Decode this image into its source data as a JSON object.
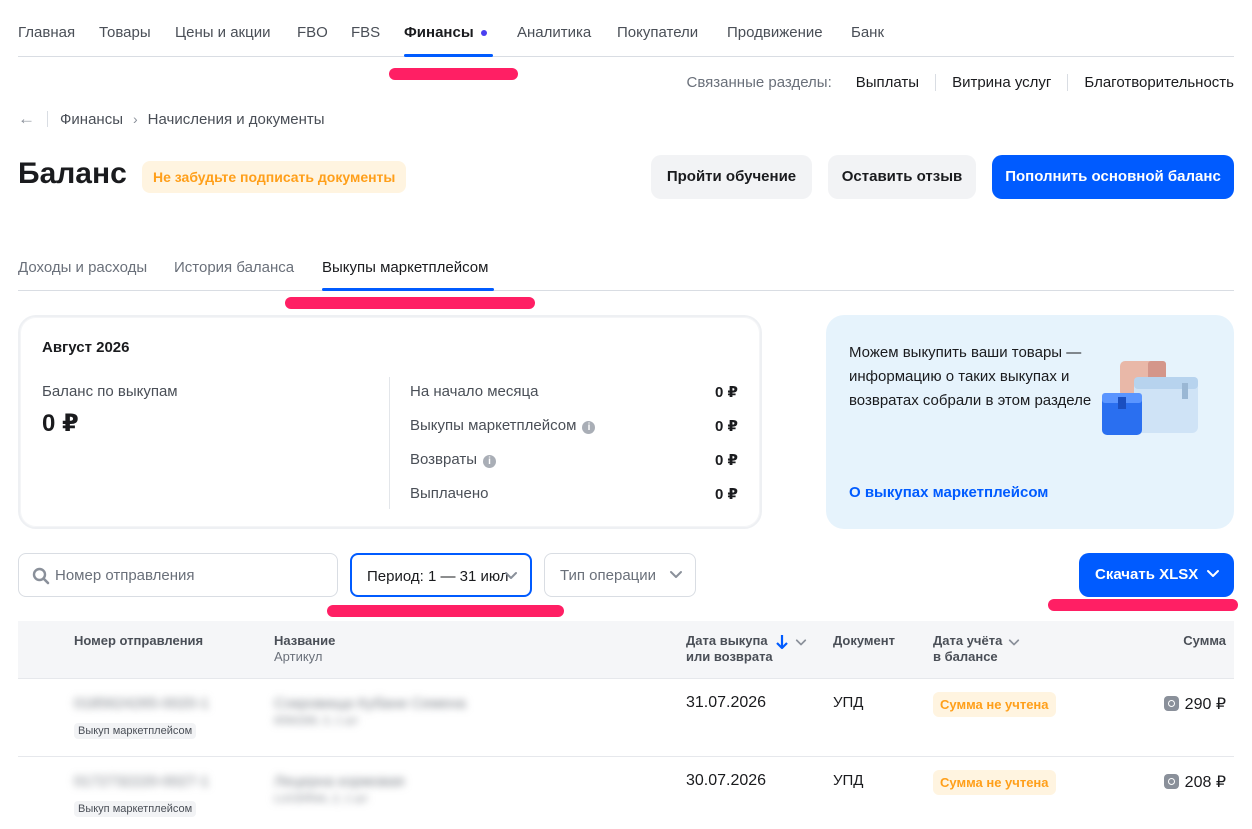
{
  "topnav": {
    "items": [
      "Главная",
      "Товары",
      "Цены и акции",
      "FBO",
      "FBS",
      "Финансы",
      "Аналитика",
      "Покупатели",
      "Продвижение",
      "Банк"
    ],
    "active_index": 5
  },
  "related": {
    "label": "Связанные разделы:",
    "links": [
      "Выплаты",
      "Витрина услуг",
      "Благотворительность"
    ]
  },
  "breadcrumb": {
    "back_icon": "arrow-left-icon",
    "items": [
      "Финансы",
      "Начисления и документы"
    ]
  },
  "page": {
    "title": "Баланс",
    "notice": "Не забудьте подписать документы"
  },
  "actions": {
    "training": "Пройти обучение",
    "feedback": "Оставить отзыв",
    "topup": "Пополнить основной баланс"
  },
  "tabs": [
    "Доходы и расходы",
    "История баланса",
    "Выкупы маркетплейсом"
  ],
  "active_tab": 2,
  "summary": {
    "month": "Август 2026",
    "balance_label": "Баланс по выкупам",
    "balance_value": "0 ₽",
    "rows": [
      {
        "label": "На начало месяца",
        "value": "0 ₽",
        "info": false
      },
      {
        "label": "Выкупы маркетплейсом",
        "value": "0 ₽",
        "info": true
      },
      {
        "label": "Возвраты",
        "value": "0 ₽",
        "info": true
      },
      {
        "label": "Выплачено",
        "value": "0 ₽",
        "info": false
      }
    ]
  },
  "promo": {
    "text": "Можем выкупить ваши товары — информацию о таких выкупах и возвратах собрали в этом разделе",
    "link": "О выкупах маркетплейсом",
    "image_icon": "boxes-illustration"
  },
  "filters": {
    "search_placeholder": "Номер отправления",
    "period": "Период: 1 — 31 июл",
    "operation_type": "Тип операции",
    "download": "Скачать XLSX"
  },
  "table": {
    "headers": {
      "shipment": "Номер отправления",
      "name": "Название",
      "name_sub": "Артикул",
      "date1": "Дата выкупа",
      "date2": "или возврата",
      "document": "Документ",
      "acc1": "Дата учёта",
      "acc2": "в балансе",
      "sum": "Сумма"
    },
    "rows": [
      {
        "shipment": "0185624265-0020-1",
        "tag": "Выкуп маркетплейсом",
        "name": "Сокровища Кубани Семена",
        "article": "6590268, 3, 1 шт",
        "date": "31.07.2026",
        "document": "УПД",
        "status": "Сумма не учтена",
        "sum": "290 ₽"
      },
      {
        "shipment": "0172732220-0027-1",
        "tag": "Выкуп маркетплейсом",
        "name": "Лецерна кормовая",
        "article": "LUCERNA, 2, 1 шт",
        "date": "30.07.2026",
        "document": "УПД",
        "status": "Сумма не учтена",
        "sum": "208 ₽"
      }
    ]
  },
  "colors": {
    "accent": "#005bff",
    "warning": "#ff9f1a",
    "annotation": "#ff1f64"
  }
}
